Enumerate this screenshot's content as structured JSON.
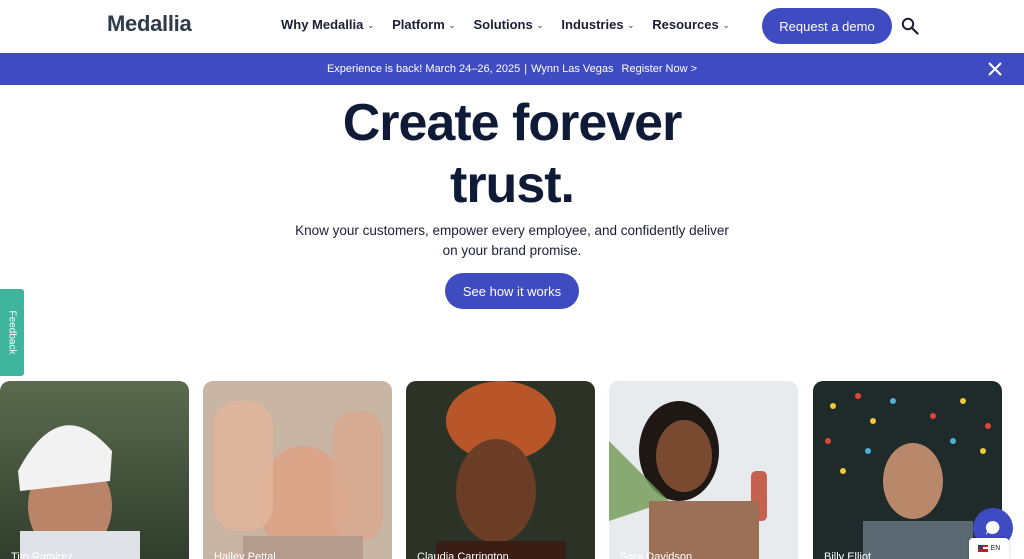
{
  "header": {
    "logo": "Medallia",
    "nav": [
      {
        "label": "Why Medallia"
      },
      {
        "label": "Platform"
      },
      {
        "label": "Solutions"
      },
      {
        "label": "Industries"
      },
      {
        "label": "Resources"
      }
    ],
    "demo_label": "Request a demo"
  },
  "banner": {
    "text": "Experience is back! March 24–26, 2025",
    "separator": "|",
    "location": "Wynn Las Vegas",
    "register_label": "Register Now >"
  },
  "hero": {
    "title_line1": "Create forever",
    "title_line2": "trust.",
    "subtitle_line1": "Know your customers, empower every employee, and confidently deliver",
    "subtitle_line2": "on your brand promise.",
    "cta_label": "See how it works"
  },
  "feedback_label": "Feedback",
  "cards": [
    {
      "name": "Tito Ramirez"
    },
    {
      "name": "Hailey Pettal"
    },
    {
      "name": "Claudia Carrington"
    },
    {
      "name": "Sara Davidson"
    },
    {
      "name": "Billy Elliot"
    }
  ],
  "language": "EN",
  "colors": {
    "brand": "#3f4bc1",
    "feedback": "#3fb59d",
    "title": "#0e1a36"
  }
}
